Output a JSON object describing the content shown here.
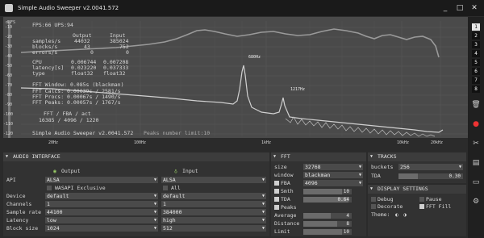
{
  "window": {
    "title": "Simple Audio Sweeper v2.0041.572",
    "minimize": "_",
    "maximize": "□",
    "close": "✕"
  },
  "plot": {
    "ylabel": "dBFS",
    "y_ticks": [
      "-10",
      "-20",
      "-30",
      "-40",
      "-50",
      "-60",
      "-70",
      "-80",
      "-90",
      "-100",
      "-110",
      "-120"
    ],
    "x_ticks": [
      "20Hz",
      "100Hz",
      "1kHz",
      "10kHz",
      "20kHz"
    ],
    "fps_line": "FPS:66 UPS:94",
    "stats_header": {
      "output": "Output",
      "input": "Input"
    },
    "stats": [
      {
        "label": "samples/s",
        "output": "44032",
        "input": "385024"
      },
      {
        "label": "blocks/s",
        "output": "43",
        "input": "752"
      },
      {
        "label": "errors/s",
        "output": "0",
        "input": "0"
      }
    ],
    "timing": [
      {
        "label": "CPU",
        "output": "0.006744",
        "input": "0.007208"
      },
      {
        "label": "latency[s]",
        "output": "0.023220",
        "input": "0.037333"
      },
      {
        "label": "type",
        "output": "float32",
        "input": "float32"
      }
    ],
    "fft_lines": [
      "FFT Window: 0.085s (blackman)",
      "FFT Calcs: 0.00039s /  2581/s",
      "FFT Procs: 0.00067s /  1490/s",
      "FFT Peaks: 0.00057s /  1767/s"
    ],
    "fft_table_header": "FFT  /  FBA  /  act",
    "fft_table_values": "16385 / 4096 / 1220",
    "footer_title": "Simple Audio Sweeper v2.0041.572",
    "peaks_info": "Peaks number limit:10",
    "peak_labels": [
      "680Hz",
      "1217Hz"
    ]
  },
  "side": {
    "numbers": [
      "1",
      "2",
      "3",
      "4",
      "5",
      "6",
      "7",
      "8"
    ],
    "icons": [
      "trash-icon",
      "record-icon",
      "tools-icon",
      "save-icon",
      "open-icon",
      "settings-icon"
    ]
  },
  "audio": {
    "title": "AUDIO INTERFACE",
    "output_label": "Output",
    "input_label": "Input",
    "api_label": "API",
    "api_out": "ALSA",
    "api_in": "ALSA",
    "wasapi_label": "WASAPI Exclusive",
    "all_label": "All",
    "device_label": "Device",
    "device_out": "default",
    "device_in": "default",
    "channels_label": "Channels",
    "channels_out": "1",
    "channels_in": "1",
    "sample_rate_label": "Sample rate",
    "sample_rate_out": "44100",
    "sample_rate_in": "384000",
    "latency_label": "Latency",
    "latency_out": "low",
    "latency_in": "high",
    "block_size_label": "Block size",
    "block_size_out": "1024",
    "block_size_in": "512"
  },
  "fft": {
    "title": "FFT",
    "size_label": "size",
    "size_value": "32768",
    "window_label": "window",
    "window_value": "blackman",
    "fba_label": "FBA",
    "fba_value": "4096",
    "smth_label": "Smth",
    "smth_value": "10",
    "tda_label": "TDA",
    "tda_value": "0.64",
    "peaks_label": "Peaks",
    "average_label": "Average",
    "average_value": "4",
    "distance_label": "Distance",
    "distance_value": "8",
    "limit_label": "Limit",
    "limit_value": "10"
  },
  "tracks": {
    "title": "TRACKS",
    "buckets_label": "buckets",
    "buckets_value": "256",
    "tda_label": "TDA",
    "tda_value": "0.30"
  },
  "display": {
    "title": "DISPLAY SETTINGS",
    "debug_label": "Debug",
    "pause_label": "Pause",
    "decorate_label": "Decorate",
    "fft_fill_label": "FFT Fill",
    "theme_label": "Theme:"
  }
}
